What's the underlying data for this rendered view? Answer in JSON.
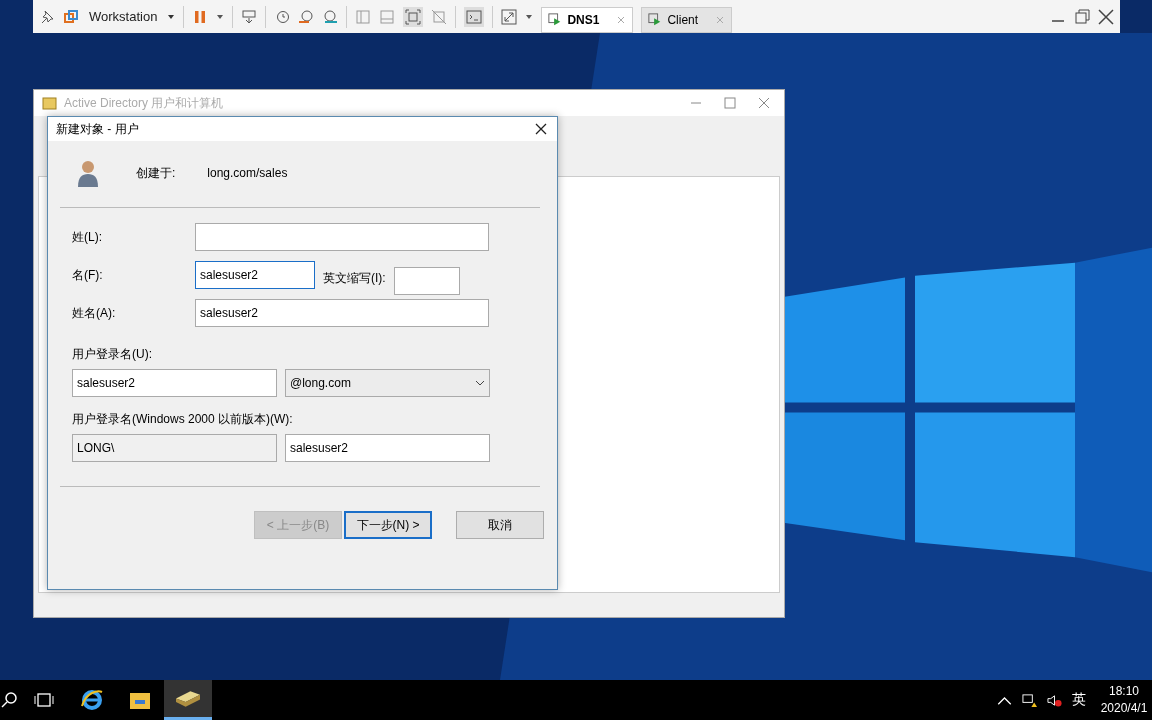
{
  "vm_toolbar": {
    "vm_name": "Workstation",
    "tabs": [
      {
        "label": "DNS1",
        "selected": true
      },
      {
        "label": "Client",
        "selected": false
      }
    ]
  },
  "background_window": {
    "title": "Active Directory 用户和计算机"
  },
  "dialog": {
    "title": "新建对象 - 用户",
    "created_in_label": "创建于:",
    "created_in_value": "long.com/sales",
    "last_name": {
      "label": "姓(L):"
    },
    "first_name": {
      "label": "名(F):",
      "value": "salesuser2"
    },
    "initials": {
      "label": "英文缩写(I):"
    },
    "full_name": {
      "label": "姓名(A):",
      "value": "salesuser2"
    },
    "logon_name": {
      "label": "用户登录名(U):",
      "value": "salesuser2",
      "domain": "@long.com"
    },
    "pre2000": {
      "label": "用户登录名(Windows 2000 以前版本)(W):",
      "domain": "LONG\\",
      "value": "salesuser2"
    },
    "buttons": [
      {
        "label": "< 上一步(B)",
        "disabled": true,
        "default": false
      },
      {
        "label": "下一步(N) >",
        "disabled": false,
        "default": true
      },
      {
        "label": "取消",
        "disabled": false,
        "default": false
      }
    ]
  },
  "taskbar": {
    "apps": [
      {
        "kind": "ie",
        "selected": false
      },
      {
        "kind": "explorer",
        "selected": false
      },
      {
        "kind": "ad",
        "selected": true
      }
    ],
    "ime": "英",
    "time": "18:10",
    "date": "2020/4/1"
  }
}
